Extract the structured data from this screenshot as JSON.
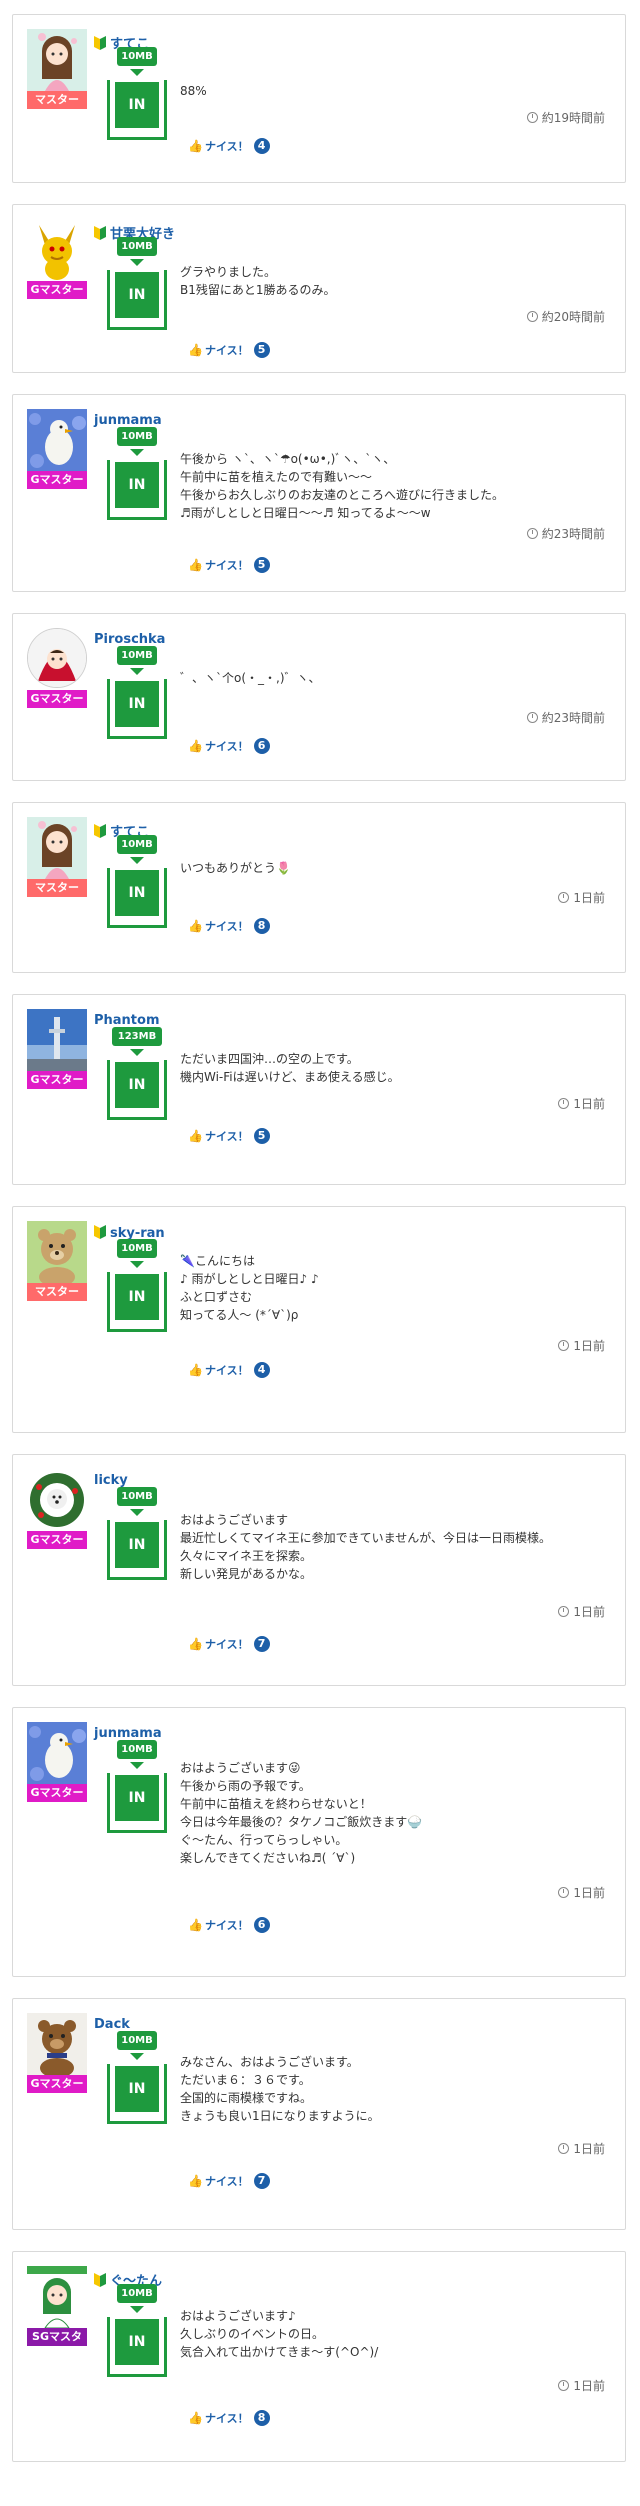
{
  "colors": {
    "accent_green": "#1e9a3e",
    "link_blue": "#1d5fa8",
    "rank_master": "#ff6a6a",
    "rank_gmaster": "#e01bc7",
    "rank_sgmaster": "#8b19a8"
  },
  "nice_label": "ナイス！",
  "posts": [
    {
      "user": "すてこ",
      "beginner_mark": true,
      "rank": "マスター",
      "rank_color": "#ff6a6a",
      "avatar": "avatar-girl",
      "cap": "10MB",
      "text": "88%",
      "time": "約19時間前",
      "nice_count": "4"
    },
    {
      "user": "甘栗大好き",
      "beginner_mark": true,
      "rank": "Gマスター",
      "rank_color": "#e01bc7",
      "avatar": "avatar-creature",
      "cap": "10MB",
      "text": "グラやりました。\nB1残留にあと1勝あるのみ。",
      "time": "約20時間前",
      "nice_count": "5"
    },
    {
      "user": "junmama",
      "beginner_mark": false,
      "rank": "Gマスター",
      "rank_color": "#e01bc7",
      "avatar": "avatar-bird-flowers",
      "cap": "10MB",
      "text": "午後から ヽ`、ヽ`☂o(•ω•,)ﾞヽ、`ヽ、\n午前中に苗を植えたので有難い〜〜\n午後からお久しぶりのお友達のところへ遊びに行きました。\n♬雨がしとしと日曜日〜〜♬ 知ってるよ〜〜w",
      "time": "約23時間前",
      "nice_count": "5"
    },
    {
      "user": "Piroschka",
      "beginner_mark": false,
      "rank": "Gマスター",
      "rank_color": "#e01bc7",
      "avatar": "avatar-red-hood",
      "cap": "10MB",
      "text": "゛、ヽ`个o(・_・,)゛ヽ、",
      "time": "約23時間前",
      "nice_count": "6"
    },
    {
      "user": "すてこ",
      "beginner_mark": true,
      "rank": "マスター",
      "rank_color": "#ff6a6a",
      "avatar": "avatar-girl",
      "cap": "10MB",
      "text": "いつもありがとう🌷",
      "time": "1日前",
      "nice_count": "8"
    },
    {
      "user": "Phantom",
      "beginner_mark": false,
      "rank": "Gマスター",
      "rank_color": "#e01bc7",
      "avatar": "avatar-tower-sky",
      "cap": "123MB",
      "text": "ただいま四国沖…の空の上です。\n機内Wi-Fiは遅いけど、まあ使える感じ。",
      "time": "1日前",
      "nice_count": "5"
    },
    {
      "user": "sky-ran",
      "beginner_mark": true,
      "rank": "マスター",
      "rank_color": "#ff6a6a",
      "avatar": "avatar-teddy-bear",
      "cap": "10MB",
      "text": "🌂こんにちは\n♪ 雨がしとしと日曜日♪ ♪\nふと口ずさむ\n知ってる人〜 (*´∀`)ρ",
      "time": "1日前",
      "nice_count": "4"
    },
    {
      "user": "licky",
      "beginner_mark": false,
      "rank": "Gマスター",
      "rank_color": "#e01bc7",
      "avatar": "avatar-dog-wreath",
      "cap": "10MB",
      "text": "おはようございます\n最近忙しくてマイネ王に参加できていませんが、今日は一日雨模様。\n久々にマイネ王を探索。\n新しい発見があるかな。",
      "time": "1日前",
      "nice_count": "7"
    },
    {
      "user": "junmama",
      "beginner_mark": false,
      "rank": "Gマスター",
      "rank_color": "#e01bc7",
      "avatar": "avatar-bird-flowers",
      "cap": "10MB",
      "text": "おはようございます😜\n午後から雨の予報です。\n午前中に苗植えを終わらせないと！\n今日は今年最後の？タケノコご飯炊きます🍚\nぐ〜たん、行ってらっしゃい。\n楽しんできてくださいね♬( ´∀`)",
      "time": "1日前",
      "nice_count": "6"
    },
    {
      "user": "Dack",
      "beginner_mark": false,
      "rank": "Gマスター",
      "rank_color": "#e01bc7",
      "avatar": "avatar-brown-bear",
      "cap": "10MB",
      "text": "みなさん、おはようございます。\nただいま６：３６です。\n全国的に雨模様ですね。\nきょうも良い1日になりますように。",
      "time": "1日前",
      "nice_count": "7"
    },
    {
      "user": "ぐ〜たん",
      "beginner_mark": true,
      "rank": "SGマスタ",
      "rank_color": "#8b19a8",
      "avatar": "avatar-green-hair-girl",
      "cap": "10MB",
      "text": "おはようございます♪\n久しぶりのイベントの日。\n気合入れて出かけてきま〜す(^O^)/",
      "time": "1日前",
      "nice_count": "8"
    }
  ]
}
